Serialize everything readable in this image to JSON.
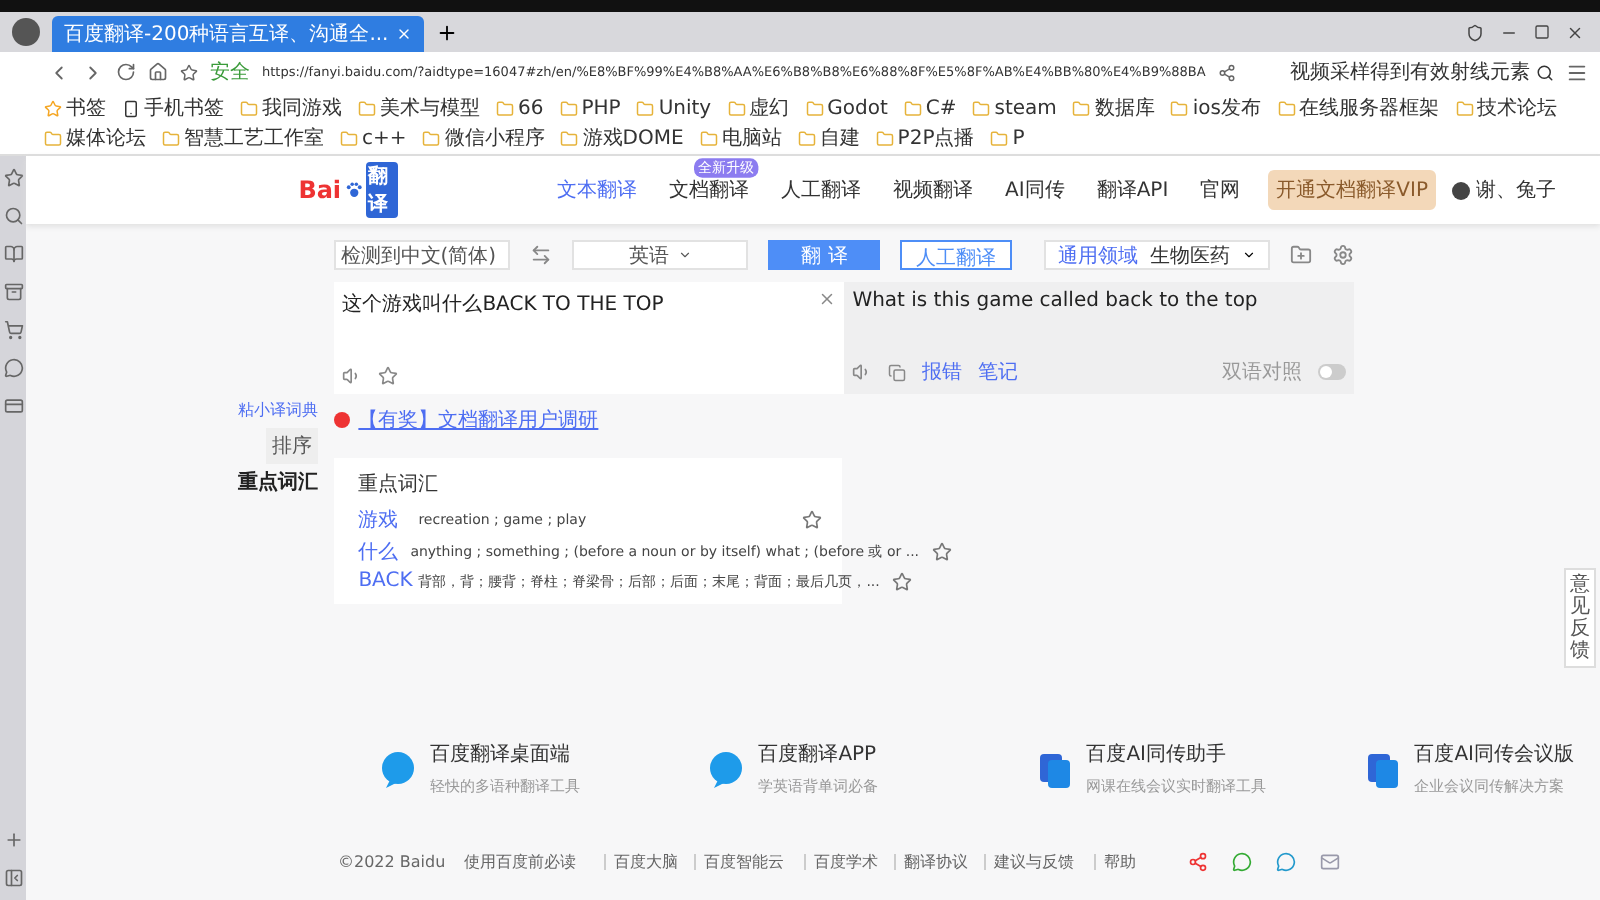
{
  "browser": {
    "tab_title": "百度翻译-200种语言互译、沟通全...",
    "security_label": "安全",
    "url": "https://fanyi.baidu.com/?aidtype=16047#zh/en/%E8%BF%99%E4%B8%AA%E6%B8%B8%E6%88%8F%E5%8F%AB%E4%BB%80%E4%B9%88BA",
    "search_hint": "视频采样得到有效射线元素",
    "bookmarks": [
      {
        "label": "书签",
        "kind": "star"
      },
      {
        "label": "手机书签",
        "kind": "phone"
      },
      {
        "label": "我同游戏",
        "kind": "folder"
      },
      {
        "label": "美术与模型",
        "kind": "folder"
      },
      {
        "label": "66",
        "kind": "folder"
      },
      {
        "label": "PHP",
        "kind": "folder"
      },
      {
        "label": "Unity",
        "kind": "folder"
      },
      {
        "label": "虚幻",
        "kind": "folder"
      },
      {
        "label": "Godot",
        "kind": "folder"
      },
      {
        "label": "C#",
        "kind": "folder"
      },
      {
        "label": "steam",
        "kind": "folder"
      },
      {
        "label": "数据库",
        "kind": "folder"
      },
      {
        "label": "ios发布",
        "kind": "folder"
      },
      {
        "label": "在线服务器框架",
        "kind": "folder"
      },
      {
        "label": "技术论坛",
        "kind": "folder"
      },
      {
        "label": "媒体论坛",
        "kind": "folder"
      },
      {
        "label": "智慧工艺工作室",
        "kind": "folder"
      },
      {
        "label": "c++",
        "kind": "folder"
      },
      {
        "label": "微信小程序",
        "kind": "folder"
      },
      {
        "label": "游戏DOME",
        "kind": "folder"
      },
      {
        "label": "电脑站",
        "kind": "folder"
      },
      {
        "label": "自建",
        "kind": "folder"
      },
      {
        "label": "P2P点播",
        "kind": "folder"
      },
      {
        "label": "P",
        "kind": "folder"
      }
    ]
  },
  "header": {
    "logo_text": "Bai",
    "logo_suffix": "翻译",
    "nav": [
      {
        "label": "文本翻译",
        "selected": true
      },
      {
        "label": "文档翻译",
        "selected": false,
        "badge": "全新升级"
      },
      {
        "label": "人工翻译",
        "selected": false
      },
      {
        "label": "视频翻译",
        "selected": false
      },
      {
        "label": "AI同传",
        "selected": false
      },
      {
        "label": "翻译API",
        "selected": false
      },
      {
        "label": "官网",
        "selected": false
      }
    ],
    "vip_button": "开通文档翻译VIP",
    "user_name": "谢、兔子"
  },
  "toolbar": {
    "source_lang": "检测到中文(简体)",
    "target_lang": "英语",
    "translate_button": "翻 译",
    "human_button": "人工翻译",
    "domain_label": "通用领域",
    "domain_value": "生物医药"
  },
  "input_text": "这个游戏叫什么BACK TO THE TOP",
  "output_text": "What is this game called back to the top",
  "output_links": [
    "报错",
    "笔记"
  ],
  "bilingual": {
    "label": "双语对照",
    "on": false
  },
  "notice": "【有奖】文档翻译用户调研",
  "side": {
    "dict_label": "粘小译词典",
    "sort_label": "排序",
    "vocab_tab": "重点词汇"
  },
  "vocab": {
    "title": "重点词汇",
    "entries": [
      {
        "word": "游戏",
        "meaning": "recreation ; game ; play",
        "starred": false
      },
      {
        "word": "什么",
        "meaning": "anything ; something ; (before a noun or by itself) what ; (before 或 or ...",
        "starred": false
      },
      {
        "word": "BACK",
        "meaning": "背部，背；腰背；脊柱；脊梁骨；后部；后面；末尾；背面；最后几页，...",
        "starred": false
      }
    ]
  },
  "apps": [
    {
      "name": "百度翻译桌面端",
      "desc": "轻快的多语种翻译工具",
      "kind": "chat"
    },
    {
      "name": "百度翻译APP",
      "desc": "学英语背单词必备",
      "kind": "chat"
    },
    {
      "name": "百度AI同传助手",
      "desc": "网课在线会议实时翻译工具",
      "kind": "doc"
    },
    {
      "name": "百度AI同传会议版",
      "desc": "企业会议同传解决方案",
      "kind": "doc"
    }
  ],
  "footer": [
    "©2022 Baidu",
    "使用百度前必读",
    "百度大脑",
    "百度智能云",
    "百度学术",
    "翻译协议",
    "建议与反馈",
    "帮助"
  ],
  "feedback": "意见反馈"
}
